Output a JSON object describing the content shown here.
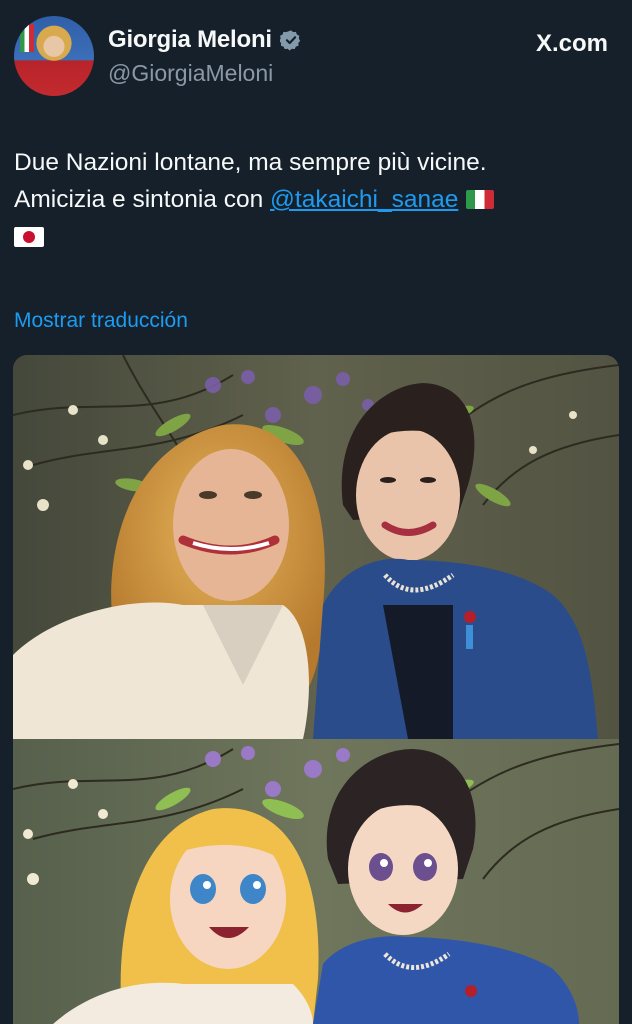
{
  "author": {
    "name": "Giorgia Meloni",
    "handle": "@GiorgiaMeloni",
    "verified_icon": "verified-badge-icon",
    "avatar_icon": "profile-avatar"
  },
  "source": {
    "label": "X.com",
    "icon": "x-logo-icon"
  },
  "tweet": {
    "line1": "Due Nazioni lontane, ma sempre più vicine.",
    "line2_prefix": "Amicizia e sintonia con ",
    "mention": "@takaichi_sanae",
    "flags": [
      "italy-flag-icon",
      "japan-flag-icon"
    ]
  },
  "translate_link": "Mostrar traducción",
  "media": {
    "photos": [
      "selfie-photo",
      "anime-style-photo"
    ]
  },
  "colors": {
    "background": "#15202b",
    "text": "#f7f9f9",
    "secondary": "#8b98a5",
    "accent": "#1d9bf0",
    "verified": "#829aab"
  }
}
